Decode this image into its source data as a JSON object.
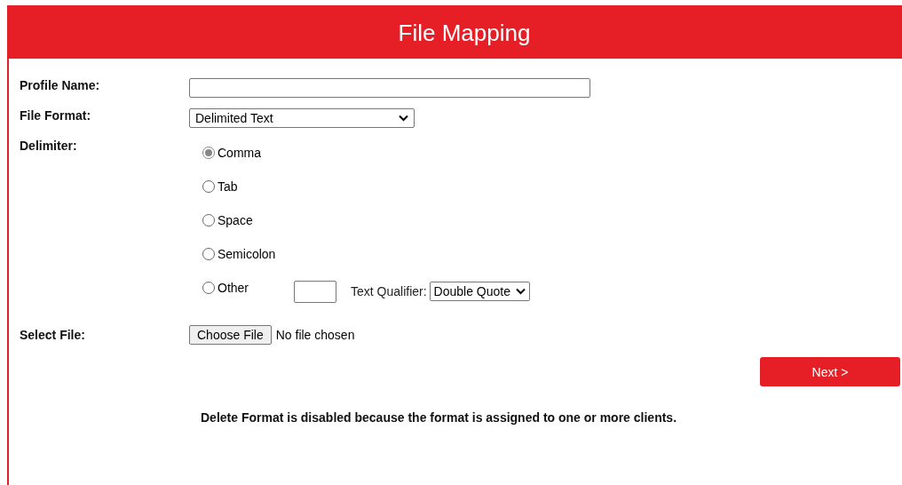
{
  "header": {
    "title": "File Mapping"
  },
  "profile_name": {
    "label": "Profile Name:"
  },
  "file_format": {
    "label": "File Format:",
    "value": "Delimited Text"
  },
  "delimiter": {
    "label": "Delimiter:",
    "options": [
      {
        "label": "Comma",
        "selected": true
      },
      {
        "label": "Tab",
        "selected": false
      },
      {
        "label": "Space",
        "selected": false
      },
      {
        "label": "Semicolon",
        "selected": false
      },
      {
        "label": "Other",
        "selected": false
      }
    ],
    "text_qualifier": {
      "label": "Text Qualifier:",
      "value": "Double Quote"
    }
  },
  "select_file": {
    "label": "Select File:",
    "button": "Choose File",
    "status": "No file chosen"
  },
  "next_button": "Next >",
  "note": "Delete Format is disabled because the format is assigned to one or more clients."
}
